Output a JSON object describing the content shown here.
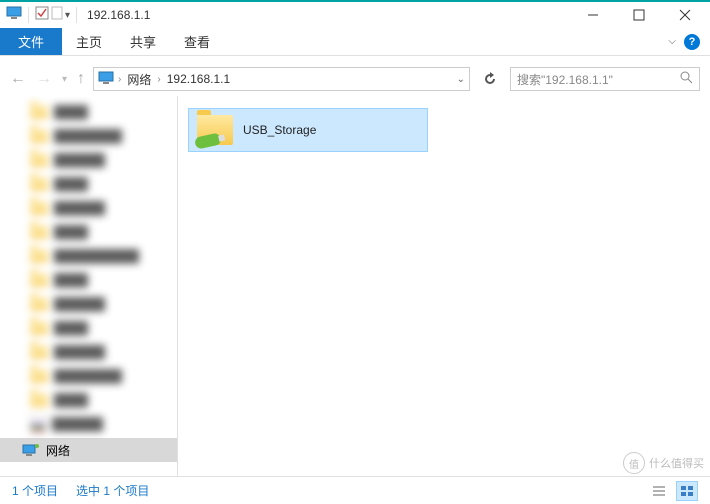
{
  "title": "192.168.1.1",
  "ribbon": {
    "file": "文件",
    "tabs": [
      "主页",
      "共享",
      "查看"
    ]
  },
  "address": {
    "root": "网络",
    "path": "192.168.1.1"
  },
  "search": {
    "placeholder": "搜索\"192.168.1.1\""
  },
  "tree": {
    "network_label": "网络"
  },
  "content": {
    "items": [
      {
        "name": "USB_Storage",
        "selected": true
      }
    ]
  },
  "status": {
    "count": "1 个项目",
    "selection": "选中 1 个项目"
  },
  "watermark": "什么值得买"
}
